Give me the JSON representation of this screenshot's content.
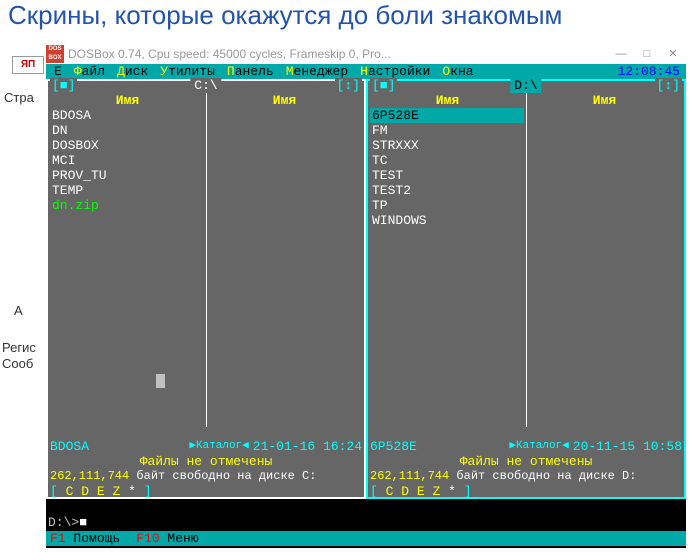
{
  "page": {
    "title": "Скрины, которые окажутся до боли знакомым",
    "side_stran": "Стра",
    "side_a": "А",
    "side_reg": "Регис",
    "side_soob": "Сооб",
    "thumb_logo": "ЯП"
  },
  "window": {
    "title": "DOSBox 0.74, Cpu speed:   45000 cycles, Frameskip  0, Pro...",
    "icon_text": "DOS BOX",
    "btn_min": "—",
    "btn_max": "□",
    "btn_close": "✕"
  },
  "menubar": {
    "e": "E",
    "items": [
      {
        "hotkey": "Ф",
        "rest": "айл"
      },
      {
        "hotkey": "Д",
        "rest": "иск"
      },
      {
        "hotkey": "У",
        "rest": "тилиты"
      },
      {
        "hotkey": "П",
        "rest": "анель"
      },
      {
        "hotkey": "М",
        "rest": "енеджер"
      },
      {
        "hotkey": "Н",
        "rest": "астройки"
      },
      {
        "hotkey": "О",
        "rest": "кна"
      }
    ],
    "clock": "12:08:45"
  },
  "left_panel": {
    "drive": " C:\\ ",
    "corner_left": "[■]",
    "corner_right": "[↕]",
    "col_header": "Имя",
    "files": [
      {
        "name": "BDOSA",
        "cls": ""
      },
      {
        "name": "DN",
        "cls": ""
      },
      {
        "name": "DOSBOX",
        "cls": ""
      },
      {
        "name": "MCI",
        "cls": ""
      },
      {
        "name": "PROV_TU",
        "cls": ""
      },
      {
        "name": "TEMP",
        "cls": ""
      },
      {
        "name": "dn.zip",
        "cls": "panel-file-zip"
      }
    ],
    "info_name": "BDOSA",
    "info_katalog": "▶Каталог◀",
    "info_date": "21-01-16 16:24",
    "marked": "Файлы не отмечены",
    "free_num": "262,111,744",
    "free_text": " байт свободно на диске C:",
    "drives_letters": "[ C D E Z * ]"
  },
  "right_panel": {
    "drive": " D:\\ ",
    "corner_left": "[■]",
    "corner_right": "[↕]",
    "col_header": "Имя",
    "files": [
      {
        "name": "6P528E",
        "cls": "panel-file-selected"
      },
      {
        "name": "FM",
        "cls": ""
      },
      {
        "name": "STRXXX",
        "cls": ""
      },
      {
        "name": "TC",
        "cls": ""
      },
      {
        "name": "TEST",
        "cls": ""
      },
      {
        "name": "TEST2",
        "cls": ""
      },
      {
        "name": "TP",
        "cls": ""
      },
      {
        "name": "WINDOWS",
        "cls": ""
      }
    ],
    "info_name": "6P528E",
    "info_katalog": "▶Каталог◀",
    "info_date": "20-11-15 10:58",
    "marked": "Файлы не отмечены",
    "free_num": "262,111,744",
    "free_text": " байт свободно на диске D:",
    "drives_letters": "[ C D E Z * ]"
  },
  "cmdline": {
    "prompt": "D:\\>",
    "cursor": "■"
  },
  "helpbar": {
    "items": [
      {
        "fkey": "F1",
        "label": " Помощь"
      },
      {
        "fkey": "F10",
        "label": " Меню"
      }
    ]
  }
}
